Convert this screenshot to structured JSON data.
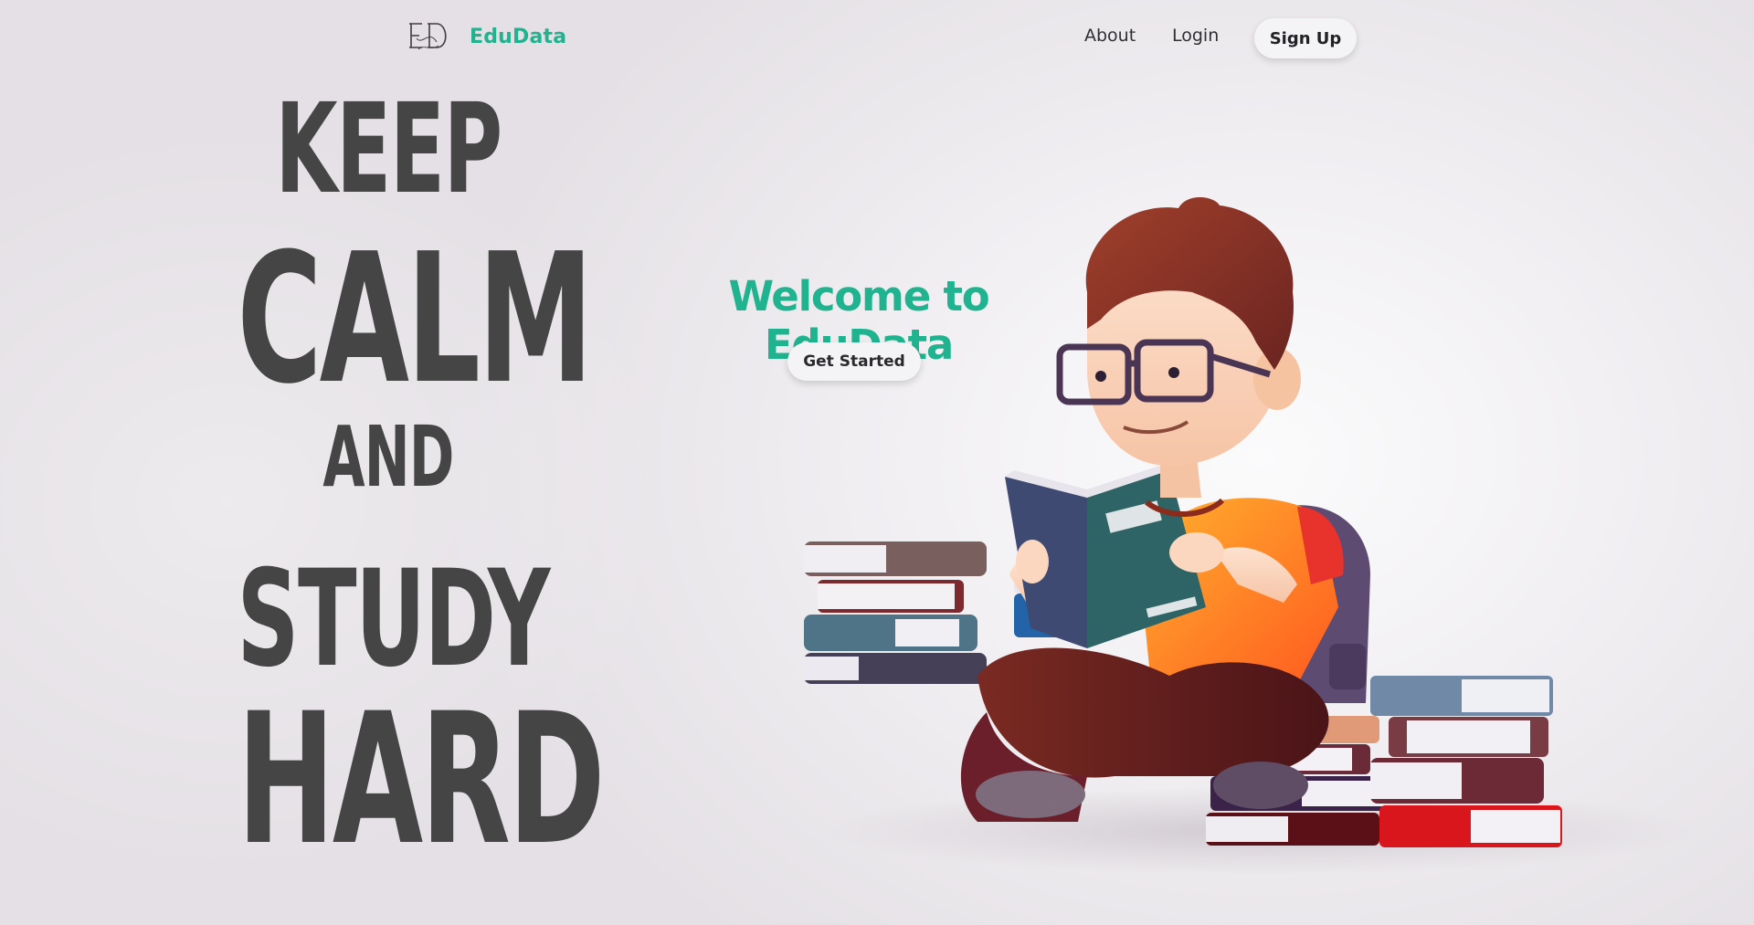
{
  "brand": {
    "name": "EduData",
    "logo_icon": "ed-monogram-logo"
  },
  "nav": {
    "about": "About",
    "login": "Login",
    "signup": "Sign Up"
  },
  "poster": {
    "line1": "KEEP",
    "line2": "CALM",
    "line3": "AND",
    "line4": "STUDY",
    "line5": "HARD"
  },
  "hero": {
    "title": "Welcome to EduData",
    "cta": "Get Started",
    "illustration": "student-reading-on-book-stacks-illustration"
  },
  "colors": {
    "accent": "#1fb48f",
    "poster_text": "#454545",
    "background": "#ece9ed",
    "button_bg": "#f4f4f6"
  }
}
